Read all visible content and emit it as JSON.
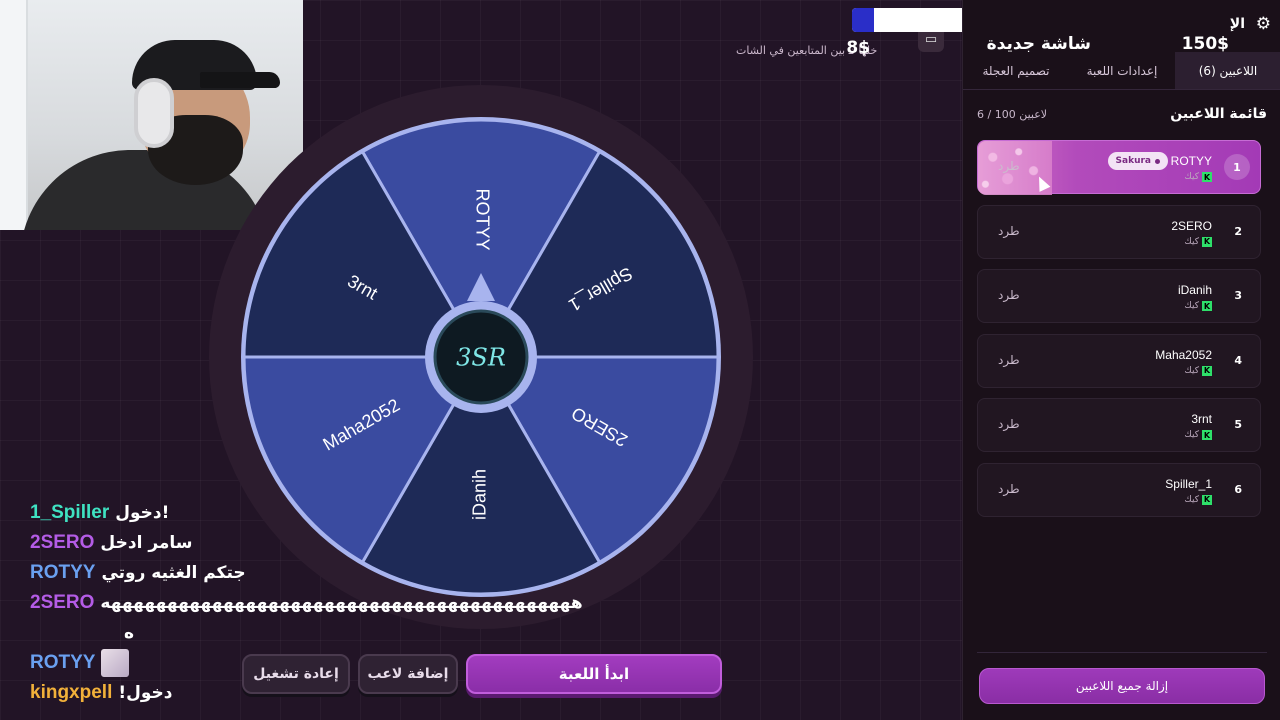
{
  "header": {
    "viewer_count": "8$",
    "hint": "خلها تـ  بين المتابعين في الشات",
    "camera_icon": "camera-icon"
  },
  "wheel": {
    "center_logo": "3SR",
    "segments": [
      "ROTYY",
      "Spiller_1",
      "2SERO",
      "iDanih",
      "Maha2052",
      "3rnt"
    ],
    "colors": [
      "#3a4ba0",
      "#1e2a57"
    ]
  },
  "chat": [
    {
      "user": "1_Spiller",
      "color": "#3fe2c2",
      "msg": "دخول!"
    },
    {
      "user": "2SERO",
      "color": "#b45ce6",
      "msg": "سامر ادخل"
    },
    {
      "user": "ROTYY",
      "color": "#6aa0f0",
      "msg": "جتكم الغثيه روتي"
    },
    {
      "user": "2SERO",
      "color": "#b45ce6",
      "msg": "ههههههههههههههههههههههههههههههههههههههههههه"
    },
    {
      "user": "",
      "color": "#ffffff",
      "msg": "ه"
    },
    {
      "user": "ROTYY",
      "color": "#6aa0f0",
      "msg": ""
    },
    {
      "user": "kingxpell",
      "color": "#f2b13a",
      "msg": "!دخول"
    }
  ],
  "buttons": {
    "restart": "إعادة تشغيل",
    "add_player": "إضافة لاعب",
    "start": "ابدأ اللعبة"
  },
  "panel": {
    "top_label": "الإ",
    "title": "شاشة جديدة",
    "price": "150$",
    "tabs": [
      "تصميم العجلة",
      "إعدادات اللعبة",
      "اللاعبين (6)"
    ],
    "list_title": "قائمة اللاعبين",
    "list_count": "6 / 100 لاعبين",
    "kick_label": "طرد",
    "platform_label": "كيك",
    "remove_all": "إزالة جميع اللاعبين",
    "players": [
      {
        "num": "1",
        "name": "ROTYY",
        "badge": "Sakura"
      },
      {
        "num": "2",
        "name": "2SERO"
      },
      {
        "num": "3",
        "name": "iDanih"
      },
      {
        "num": "4",
        "name": "Maha2052"
      },
      {
        "num": "5",
        "name": "3rnt"
      },
      {
        "num": "6",
        "name": "Spiller_1"
      }
    ]
  }
}
